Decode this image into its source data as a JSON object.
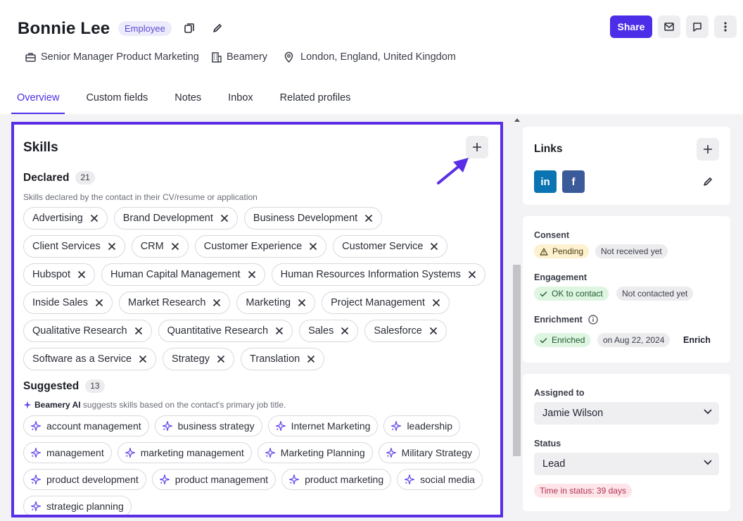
{
  "profile": {
    "name": "Bonnie Lee",
    "type_badge": "Employee",
    "title": "Senior Manager Product Marketing",
    "company": "Beamery",
    "location": "London, England, United Kingdom"
  },
  "actions": {
    "share_label": "Share"
  },
  "tabs": [
    {
      "label": "Overview",
      "active": true
    },
    {
      "label": "Custom fields"
    },
    {
      "label": "Notes"
    },
    {
      "label": "Inbox"
    },
    {
      "label": "Related profiles"
    }
  ],
  "skills": {
    "title": "Skills",
    "declared": {
      "label": "Declared",
      "count": "21",
      "description": "Skills declared by the contact in their CV/resume or application",
      "items": [
        "Advertising",
        "Brand Development",
        "Business Development",
        "Client Services",
        "CRM",
        "Customer Experience",
        "Customer Service",
        "Hubspot",
        "Human Capital Management",
        "Human Resources Information Systems",
        "Inside Sales",
        "Market Research",
        "Marketing",
        "Project Management",
        "Qualitative Research",
        "Quantitative Research",
        "Sales",
        "Salesforce",
        "Software as a Service",
        "Strategy",
        "Translation"
      ]
    },
    "suggested": {
      "label": "Suggested",
      "count": "13",
      "ai_name": "Beamery AI",
      "description": " suggests skills based on the contact's primary job title.",
      "items": [
        "account management",
        "business strategy",
        "Internet Marketing",
        "leadership",
        "management",
        "marketing management",
        "Marketing Planning",
        "Military Strategy",
        "product development",
        "product management",
        "product marketing",
        "social media",
        "strategic planning"
      ]
    }
  },
  "links": {
    "title": "Links",
    "items": [
      {
        "name": "linkedin-icon",
        "glyph": "in",
        "color": "#0a73b1"
      },
      {
        "name": "facebook-icon",
        "glyph": "f",
        "color": "#3b5a9a"
      }
    ]
  },
  "status_card": {
    "consent_label": "Consent",
    "consent_status": "Pending",
    "consent_detail": "Not received yet",
    "engagement_label": "Engagement",
    "engagement_status": "OK to contact",
    "engagement_detail": "Not contacted yet",
    "enrichment_label": "Enrichment",
    "enrichment_status": "Enriched",
    "enrichment_date": "on Aug 22, 2024",
    "enrich_button": "Enrich"
  },
  "assign_card": {
    "assigned_label": "Assigned to",
    "assigned_value": "Jamie Wilson",
    "status_label": "Status",
    "status_value": "Lead",
    "time_in_status": "Time in status: 39 days"
  },
  "colors": {
    "accent": "#4d2ee8",
    "highlight_border": "#5a2ee6"
  }
}
